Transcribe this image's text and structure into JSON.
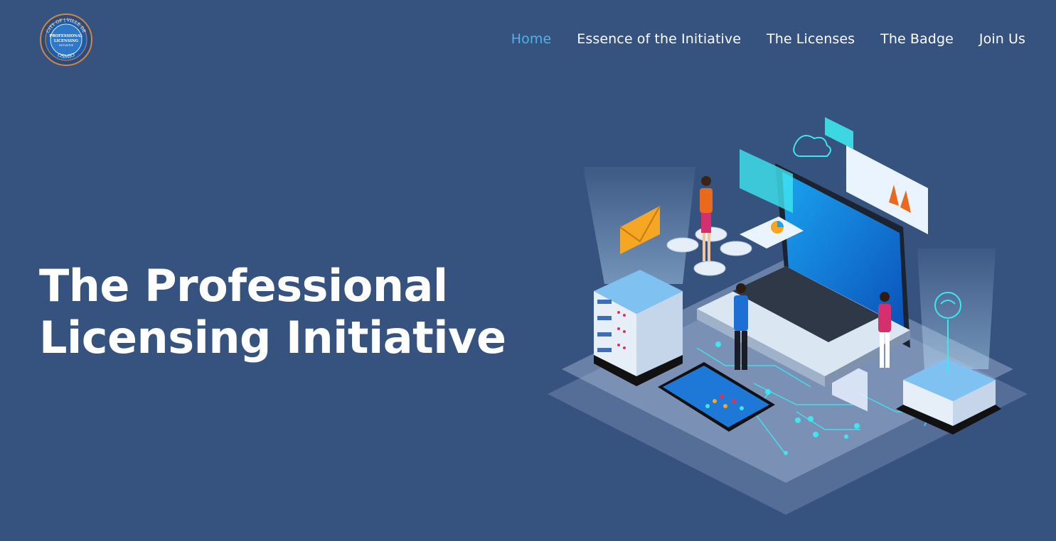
{
  "logo": {
    "arc_top": "CITY OF | VILLE DE",
    "line1": "PROFESSIONAL",
    "line2": "LICENSING",
    "line3": "INITIATIVE",
    "arc_bottom": "OSMIO"
  },
  "nav": {
    "items": [
      {
        "label": "Home",
        "active": true
      },
      {
        "label": "Essence of the Initiative",
        "active": false
      },
      {
        "label": "The Licenses",
        "active": false
      },
      {
        "label": "The Badge",
        "active": false
      },
      {
        "label": "Join Us",
        "active": false
      }
    ]
  },
  "hero": {
    "title_line1": "The Professional",
    "title_line2": "Licensing Initiative"
  },
  "colors": {
    "background": "#36527f",
    "nav_active": "#4fb3e8",
    "text": "#ffffff",
    "accent_cyan": "#3ee6f0"
  },
  "icons": [
    "seal-logo",
    "isometric-network-illustration"
  ]
}
